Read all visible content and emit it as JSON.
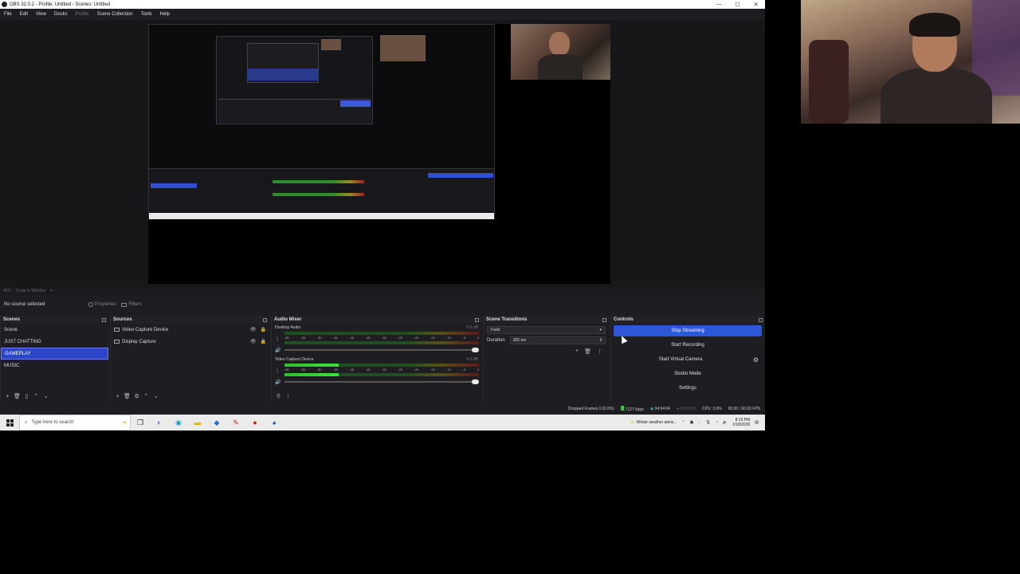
{
  "window": {
    "title": "OBS 32.0.2 - Profile: Untitled - Scenes: Untitled",
    "minimize": "—",
    "maximize": "☐",
    "close": "✕"
  },
  "menu": {
    "file": "File",
    "edit": "Edit",
    "view": "View",
    "docks": "Docks",
    "profile": "Profile",
    "scene_collection": "Scene Collection",
    "tools": "Tools",
    "help": "Help"
  },
  "preview": {
    "zoom": "45%",
    "scale_mode": "Scale to Window"
  },
  "props_bar": {
    "no_source": "No source selected",
    "properties": "Properties",
    "filters": "Filters"
  },
  "scenes": {
    "title": "Scenes",
    "items": [
      "Scene",
      "JUST CHATTING",
      "GAMEPLAY",
      "MUSIC"
    ],
    "selected": "GAMEPLAY"
  },
  "sources": {
    "title": "Sources",
    "items": [
      "Video Capture Device",
      "Display Capture"
    ]
  },
  "mixer": {
    "title": "Audio Mixer",
    "channels": [
      {
        "name": "Desktop Audio",
        "db": "0.0 dB",
        "level": 0.0
      },
      {
        "name": "Video Capture Device",
        "db": "0.0 dB",
        "level": 0.28
      }
    ],
    "ticks": [
      "-60",
      "-55",
      "-50",
      "-45",
      "-40",
      "-35",
      "-30",
      "-25",
      "-20",
      "-15",
      "-10",
      "-5",
      "0"
    ]
  },
  "transitions": {
    "title": "Scene Transitions",
    "selected": "Fade",
    "duration_label": "Duration",
    "duration_value": "300 ms"
  },
  "controls": {
    "title": "Controls",
    "stop_streaming": "Stop Streaming",
    "start_recording": "Start Recording",
    "start_virtual_camera": "Start Virtual Camera",
    "studio_mode": "Studio Mode",
    "settings": "Settings"
  },
  "status": {
    "dropped_frames": "Dropped Frames 0 (0.0%)",
    "bitrate": "7127 kbps",
    "stream_time": "04:54:04",
    "record_time": "00:00:00",
    "cpu": "CPU: 3.6%",
    "fps": "60.00 / 60.00 FPS"
  },
  "taskbar": {
    "search_placeholder": "Type here to search",
    "weather": "Winter weather advis...",
    "time": "8:19 PM",
    "date": "1/18/2026"
  },
  "colors": {
    "accent": "#2f55d8",
    "panel": "#1e1e22",
    "meter_green": "#3ee03e"
  }
}
